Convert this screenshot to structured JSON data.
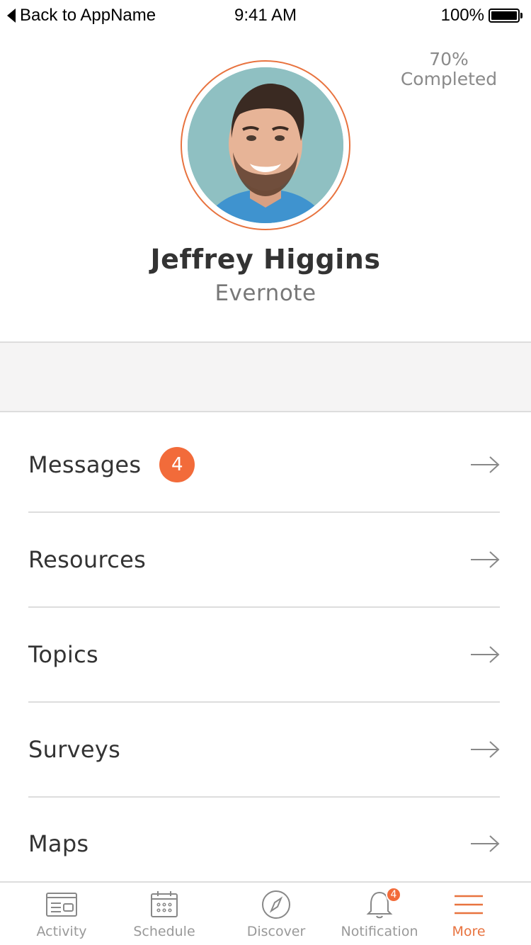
{
  "status_bar": {
    "back_label": "Back to AppName",
    "time": "9:41 AM",
    "battery_percent": "100%",
    "battery_level": 1.0
  },
  "completion": {
    "percent": "70%",
    "label": "Completed"
  },
  "profile": {
    "name": "Jeffrey Higgins",
    "company": "Evernote",
    "avatar_icon": "user-photo",
    "ring_color": "#e8733f"
  },
  "menu": {
    "items": [
      {
        "label": "Messages",
        "badge": "4",
        "icon": "arrow-right-icon"
      },
      {
        "label": "Resources",
        "icon": "arrow-right-icon"
      },
      {
        "label": "Topics",
        "icon": "arrow-right-icon"
      },
      {
        "label": "Surveys",
        "icon": "arrow-right-icon"
      },
      {
        "label": "Maps",
        "icon": "arrow-right-icon"
      }
    ]
  },
  "tab_bar": {
    "active": "More",
    "active_color": "#e8733f",
    "tabs": [
      {
        "label": "Activity",
        "icon": "activity-card-icon"
      },
      {
        "label": "Schedule",
        "icon": "calendar-icon"
      },
      {
        "label": "Discover",
        "icon": "compass-icon"
      },
      {
        "label": "Notification",
        "icon": "bell-icon",
        "badge": "4"
      },
      {
        "label": "More",
        "icon": "hamburger-menu-icon"
      }
    ]
  },
  "colors": {
    "accent": "#f26b3a",
    "divider": "#dddddd",
    "band": "#f5f4f4"
  }
}
